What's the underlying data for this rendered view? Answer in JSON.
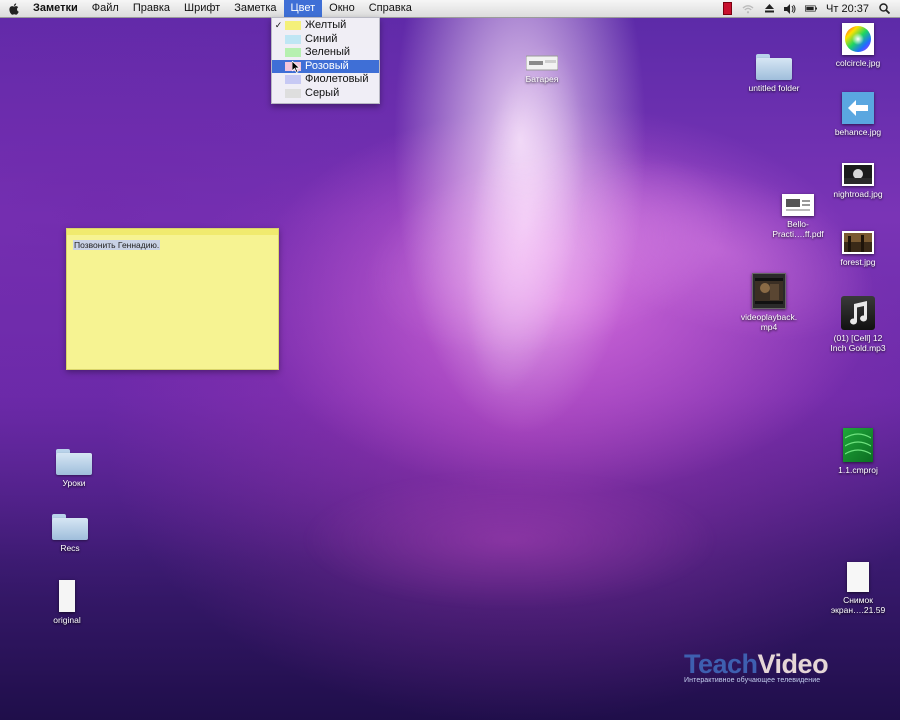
{
  "menubar": {
    "app_name": "Заметки",
    "items": [
      "Файл",
      "Правка",
      "Шрифт",
      "Заметка",
      "Цвет",
      "Окно",
      "Справка"
    ],
    "active_item": "Цвет",
    "clock": "Чт 20:37"
  },
  "color_menu": {
    "items": [
      {
        "label": "Желтый",
        "swatch": "#f4f07a",
        "checked": true
      },
      {
        "label": "Синий",
        "swatch": "#bfe6f4"
      },
      {
        "label": "Зеленый",
        "swatch": "#b6f0b0"
      },
      {
        "label": "Розовый",
        "swatch": "#f3c5da",
        "highlighted": true
      },
      {
        "label": "Фиолетовый",
        "swatch": "#c7c9f4"
      },
      {
        "label": "Серый",
        "swatch": "#dedede"
      }
    ]
  },
  "note": {
    "text": "Позвонить Геннадию.",
    "color": "#f6f392"
  },
  "desktop_icons": {
    "battery": "Батарея",
    "untitled_folder": "untitled folder",
    "colcircle": "colcircle.jpg",
    "behance": "behance.jpg",
    "nightroad": "nightroad.jpg",
    "bello": "Bello-\nPracti….ff.pdf",
    "forest": "forest.jpg",
    "videoplayback": "videoplayback.\nmp4",
    "mp3": "(01) [Cell] 12\nInch Gold.mp3",
    "cmproj": "1.1.cmproj",
    "uroki": "Уроки",
    "recs": "Recs",
    "original": "original",
    "screenshot": "Снимок\nэкран….21.59"
  },
  "watermark": {
    "brand_part1": "Teach",
    "brand_part2": "Video",
    "tagline": "Интерактивное обучающее телевидение"
  }
}
